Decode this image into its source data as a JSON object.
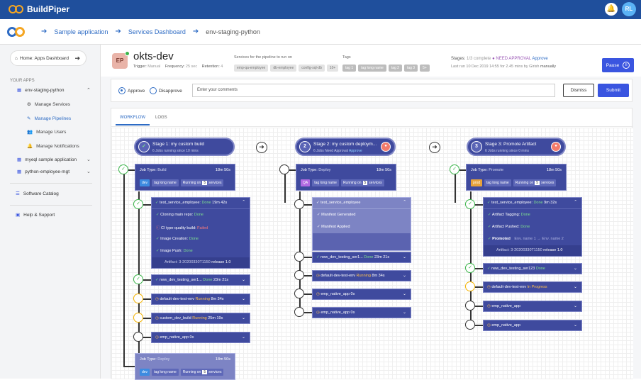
{
  "app": {
    "name": "BuildPiper",
    "user_initials": "RL"
  },
  "breadcrumb": [
    "Sample application",
    "Services Dashboard",
    "env-staging-python"
  ],
  "sidebar": {
    "home": "Home: Apps Dashboard",
    "section": "YOUR APPS",
    "apps": [
      {
        "label": "env-staging-python",
        "subs": [
          "Manage Services",
          "Manage Pipelines",
          "Manage Users",
          "Manage Notifications"
        ]
      },
      {
        "label": "myeql sample application"
      },
      {
        "label": "python-employee-mgt"
      }
    ],
    "software_catalog": "Software Catalog",
    "help": "Help & Support"
  },
  "header": {
    "avatar": "EP",
    "name": "okts-dev",
    "trigger_label": "Trigger:",
    "trigger": "Manual",
    "frequency_label": "Frequency:",
    "frequency": "25 sec",
    "retention_label": "Retention:",
    "retention": "4",
    "services_label": "Services for the pipeline to run on",
    "services": [
      "emp-qa-employee",
      "db-employee",
      "config-sql-db",
      "10+"
    ],
    "tags_label": "Tags",
    "tags": [
      "tag 1",
      "tag long name",
      "tag 2",
      "tag 3",
      "5+"
    ],
    "stages_label": "Stages:",
    "stages_progress": "1/3 complete",
    "need_approval": "NEED APPROVAL",
    "approve": "Approve",
    "last_run_label": "Last run",
    "last_run": "10 Dec 2019 14:55",
    "for_label": "for",
    "duration": "2.45 mins",
    "by_label": "by",
    "by": "Girish",
    "mode": "manually",
    "pause": "Pause"
  },
  "approval": {
    "approve": "Approve",
    "disapprove": "Disapprove",
    "comment_placeholder": "Enter your comments",
    "dismiss": "Dismiss",
    "submit": "Submit"
  },
  "tabs": [
    "WORKFLOW",
    "LOGS"
  ],
  "stages": [
    {
      "title": "Stage 1: my custom build",
      "sub": "6 Jobs running since 10 mins",
      "sub_link": ""
    },
    {
      "title": "Stage 2: my custom deploym...",
      "sub": "6 Jobs Need Approval",
      "sub_link": "Approve"
    },
    {
      "title": "Stage 3: Promote Artifact",
      "sub": "6 Jobs running since 0 mins",
      "sub_link": ""
    }
  ],
  "job_card": {
    "job_type_label": "Job Type:",
    "running_on": "Running on",
    "count": "5",
    "services": "services",
    "tag": "tag long name"
  },
  "jobs": {
    "s1": {
      "type": "Build",
      "time": "18m 50s",
      "env": "dev",
      "env_color": "#3d8be0"
    },
    "s2": {
      "type": "Deploy",
      "time": "18m 50s",
      "env": "QA",
      "env_color": "#b36ae2"
    },
    "s3": {
      "type": "Promote",
      "time": "18m 50s",
      "env": "prod",
      "env_color": "#e6a23c"
    },
    "s1b": {
      "type": "Deploy",
      "time": "18m 50s",
      "env": "dev",
      "env_color": "#3d8be0"
    }
  },
  "s1_expanded": {
    "name": "test_service_employee:",
    "status": "Done",
    "time": "19m 42s",
    "steps": [
      {
        "label": "Cloning main repo:",
        "status": "Done",
        "kind": "ok"
      },
      {
        "label": "CI type quality build:",
        "status": "Failed",
        "kind": "fail"
      },
      {
        "label": "Image Creation:",
        "status": "Done",
        "kind": "ok"
      },
      {
        "label": "Image Push:",
        "status": "Done",
        "kind": "ok"
      }
    ],
    "artifact_label": "Artifact:",
    "artifact": "3-20200330T1150",
    "release": "release 1.0"
  },
  "s1_services": [
    {
      "name": "new_dev_testing_ser1...",
      "status": "Done",
      "time": "23m 21s",
      "kind": "done"
    },
    {
      "name": "default-dev-test-env",
      "status": "Running",
      "time": "8m 34s",
      "kind": "run"
    },
    {
      "name": "custom_dev_build",
      "status": "Running",
      "time": "25m 19s",
      "kind": "run"
    },
    {
      "name": "emp_native_app",
      "status": "",
      "time": "0s",
      "kind": "idle"
    }
  ],
  "s2_expanded": {
    "name": "test_service_employee",
    "steps": [
      "Manifest Generated",
      "Manifest Applied"
    ]
  },
  "s2_services": [
    {
      "name": "new_dev_testing_ser1...",
      "status": "Done",
      "time": "23m 21s",
      "kind": "done"
    },
    {
      "name": "default-dev-test-env",
      "status": "Running",
      "time": "8m 34s",
      "kind": "run"
    },
    {
      "name": "emp_native_app",
      "status": "",
      "time": "0s",
      "kind": "idle"
    },
    {
      "name": "emp_native_app",
      "status": "",
      "time": "0s",
      "kind": "idle"
    }
  ],
  "s3_expanded": {
    "name": "test_service_employee:",
    "status": "Done",
    "time": "9m 32s",
    "steps": [
      {
        "label": "Artifact Tagging:",
        "status": "Done"
      },
      {
        "label": "Artifact Pushed:",
        "status": "Done"
      }
    ],
    "promoted": "Promoted",
    "env_from": "Env. name 1",
    "env_to": "Env. name 2",
    "artifact_label": "Artifact:",
    "artifact": "3-20200330T1150",
    "release": "release 1.0"
  },
  "s3_services": [
    {
      "name": "new_dev_testing_ser123",
      "status": "Done",
      "time": "",
      "kind": "done"
    },
    {
      "name": "default-dev-test-env",
      "status": "In Progress",
      "time": "",
      "kind": "run"
    },
    {
      "name": "emp_native_app",
      "status": "",
      "time": "",
      "kind": "idle"
    },
    {
      "name": "emp_native_app",
      "status": "",
      "time": "",
      "kind": "idle"
    }
  ]
}
